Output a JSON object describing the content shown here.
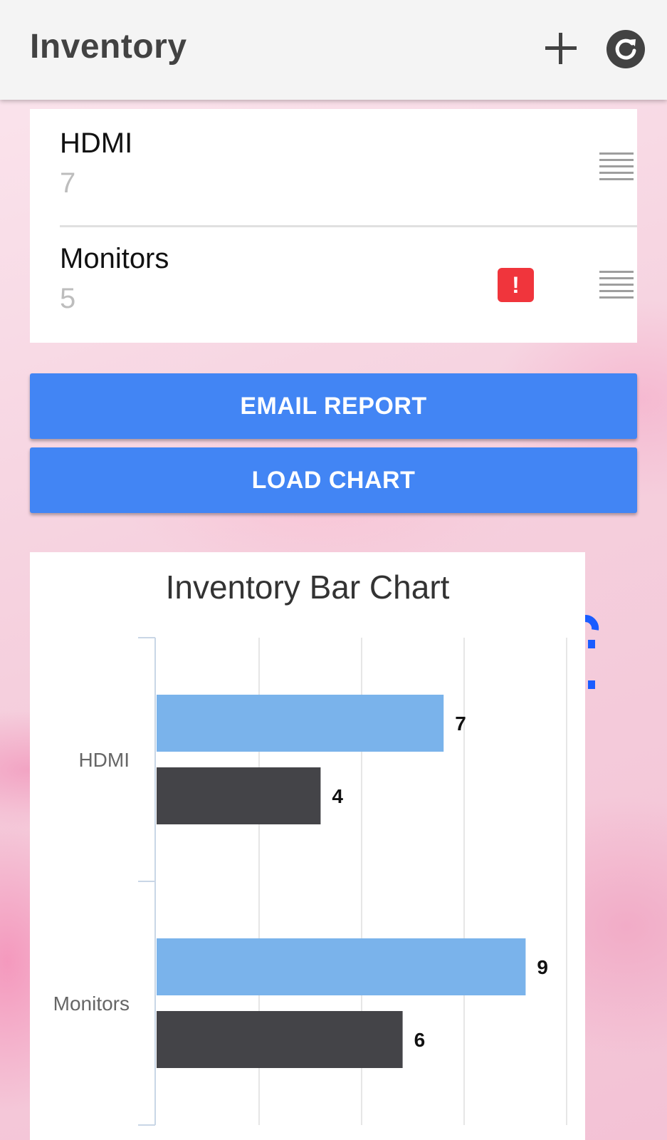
{
  "app": {
    "title": "Inventory",
    "actions": [
      {
        "name": "add-button",
        "icon": "plus-icon"
      },
      {
        "name": "refresh-button",
        "icon": "refresh-icon"
      }
    ]
  },
  "inventory": {
    "items": [
      {
        "name": "HDMI",
        "quantity": "7",
        "alert": false
      },
      {
        "name": "Monitors",
        "quantity": "5",
        "alert": true,
        "alert_symbol": "!"
      }
    ]
  },
  "buttons": {
    "email_report": "EMAIL REPORT",
    "load_chart": "LOAD CHART"
  },
  "colors": {
    "accent": "#4285f4",
    "alert": "#f0353c",
    "series_light": "#7ab3eb",
    "series_dark": "#444448"
  },
  "chart_data": {
    "type": "bar",
    "orientation": "horizontal",
    "title": "Inventory Bar Chart",
    "categories": [
      "HDMI",
      "Monitors"
    ],
    "series": [
      {
        "values": [
          7,
          9
        ],
        "color": "#7ab3eb"
      },
      {
        "values": [
          4,
          6
        ],
        "color": "#444448"
      }
    ],
    "xlim": [
      0,
      10
    ],
    "grid": true,
    "data_labels": true,
    "legend": "none"
  }
}
